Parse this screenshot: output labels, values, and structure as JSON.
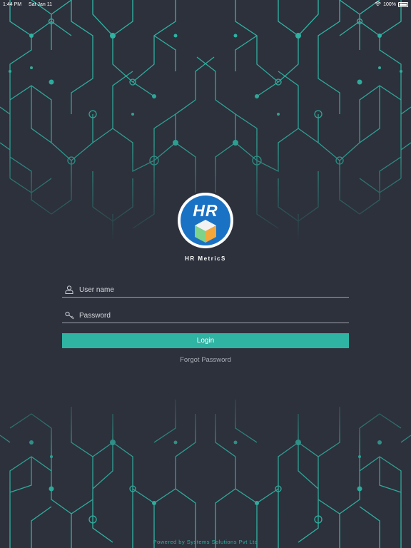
{
  "status_bar": {
    "time": "1:44 PM",
    "date": "Sat Jan 11",
    "battery": "100%"
  },
  "logo": {
    "text": "HR",
    "colors": {
      "circle": "#1a72c4",
      "ring": "#ffffff"
    }
  },
  "app": {
    "title": "HR MetricS"
  },
  "form": {
    "username_placeholder": "User name",
    "username_value": "",
    "password_placeholder": "Password",
    "password_value": "",
    "login_label": "Login",
    "forgot_label": "Forgot Password"
  },
  "footer": {
    "text": "Powered by Systems Solutions Pvt Ltd"
  },
  "icons": {
    "username": "user-icon",
    "password": "key-icon",
    "wifi": "wifi-icon",
    "battery": "battery-icon"
  },
  "colors": {
    "background": "#2d313c",
    "accent": "#2fb4a4",
    "circuit": "#2fb9a7"
  }
}
